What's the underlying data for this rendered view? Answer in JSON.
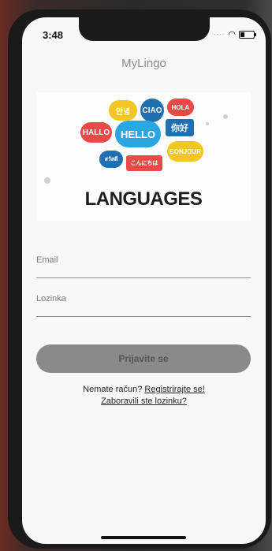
{
  "status_bar": {
    "time": "3:48"
  },
  "app": {
    "title": "MyLingo"
  },
  "banner": {
    "text": "LANGUAGES",
    "bubbles": [
      "안녕",
      "CIAO",
      "HOLA",
      "HALLO",
      "HELLO",
      "你好",
      "สวัสดี",
      "こんにちは",
      "BONJOUR"
    ]
  },
  "form": {
    "email_label": "Email",
    "password_label": "Lozinka",
    "login_label": "Prijavite se"
  },
  "links": {
    "no_account_text": "Nemate račun?",
    "register_label": "Registrirajte se!",
    "forgot_label": "Zaboravili ste lozinku?"
  },
  "colors": {
    "screen_bg": "#f8f8f8",
    "button_bg": "#8a8a8a",
    "title_color": "#8c8c8c"
  }
}
